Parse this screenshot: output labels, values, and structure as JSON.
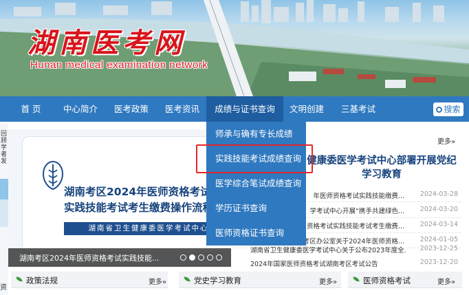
{
  "site": {
    "title": "湖南医考网",
    "subtitle": "Hunan medical examination network"
  },
  "nav": {
    "items": [
      {
        "label": "首 页"
      },
      {
        "label": "中心简介"
      },
      {
        "label": "医考政策"
      },
      {
        "label": "医考资讯"
      },
      {
        "label": "成绩与证书查询"
      },
      {
        "label": "文明创建"
      },
      {
        "label": "三基考试"
      }
    ],
    "active_index": 4,
    "search_label": "搜索"
  },
  "dropdown": {
    "items": [
      {
        "label": "师承与确有专长成绩"
      },
      {
        "label": "实践技能考试成绩查询"
      },
      {
        "label": "医学综合笔试成绩查询"
      },
      {
        "label": "学历证书查询"
      },
      {
        "label": "医师资格证书查询"
      }
    ],
    "highlighted_index": 1
  },
  "carousel": {
    "slide_title_line1": "湖南考区2024年医师资格考试",
    "slide_title_line2": "实践技能考试考生缴费操作流程",
    "slide_org": "湖南省卫生健康委医学考试中心",
    "caption": "湖南考区2024年医师资格考试实践技能...",
    "dots": 5,
    "active_dot": 1
  },
  "side_strip": {
    "text": "回顾学者发"
  },
  "news": {
    "more": "更多»",
    "headline": "健康委医学考试中心部署开展党纪学习教育",
    "items": [
      {
        "title": "年医师资格考试实践技能缴费...",
        "date": "2024-03-28"
      },
      {
        "title": "学考试中心开展“携手共建绿色...",
        "date": "2024-03-20"
      },
      {
        "title": "资格考试实践技能考试考生缴费...",
        "date": "2024-03-14"
      },
      {
        "title": "考区办公室关于2024年医师资格...",
        "date": "2024-01-05"
      },
      {
        "title": "湖南省卫生健康委医学考试中心关于公布2023年度全...",
        "date": "2023-12-25"
      },
      {
        "title": "2024年国家医师资格考试湖南考区考试公告",
        "date": "2023-12-20"
      }
    ]
  },
  "panels": [
    {
      "title": "政策法规",
      "more": "更多»"
    },
    {
      "title": "党史学习教育",
      "more": "更多»"
    },
    {
      "title": "医师资格考试",
      "more": "更多»"
    }
  ],
  "bottom_left": "资",
  "colors": {
    "nav": "#2f79c0",
    "nav_active": "#1e5da0",
    "title_red": "#d8141c",
    "highlight": "#e2262b",
    "headline_blue": "#17437d"
  }
}
